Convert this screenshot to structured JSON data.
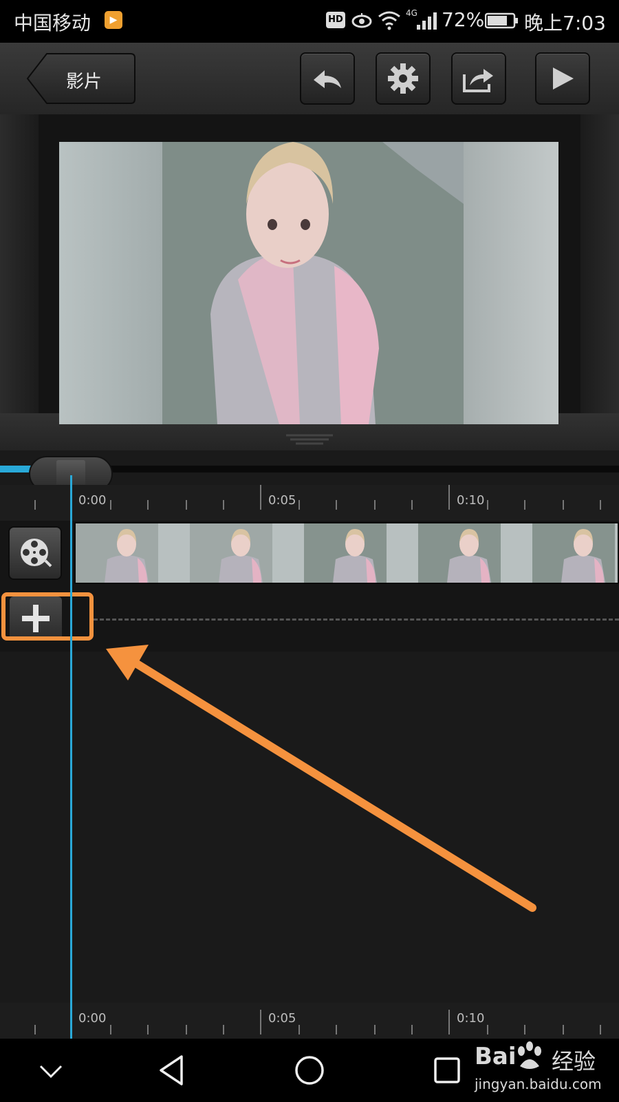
{
  "status_bar": {
    "carrier": "中国移动",
    "hd_label": "HD",
    "network_label": "4G",
    "battery_percent": "72%",
    "time": "晚上7:03"
  },
  "toolbar": {
    "back_label": "影片",
    "icons": [
      "undo-icon",
      "gear-icon",
      "share-icon",
      "play-icon"
    ]
  },
  "timeline": {
    "tick_labels": [
      "0:00",
      "0:05",
      "0:10"
    ],
    "bottom_tick_labels": [
      "0:00",
      "0:05",
      "0:10"
    ],
    "clip_thumbnail_count": 5
  },
  "watermark": {
    "brand_text": "Bai",
    "brand_cn": "经验",
    "domain_text": "jingyan.baidu.com"
  },
  "colors": {
    "accent": "#29a9d8",
    "annotation": "#f5923e",
    "background": "#1a1a1a"
  }
}
